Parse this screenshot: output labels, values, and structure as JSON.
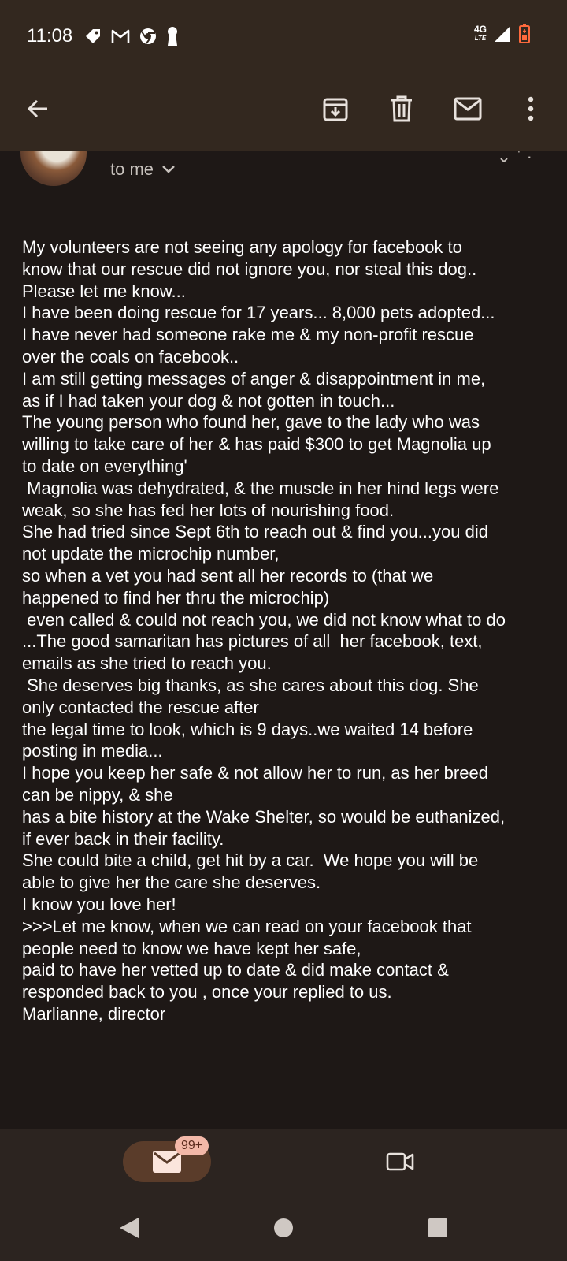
{
  "status_bar": {
    "time": "11:08",
    "network": "4G",
    "network_sub": "LTE",
    "icons": [
      "tag-icon",
      "gmail-icon",
      "chrome-icon",
      "keyhole-icon",
      "signal-icon",
      "battery-icon"
    ]
  },
  "toolbar": {
    "icons": [
      "back-arrow-icon",
      "archive-icon",
      "delete-icon",
      "mark-unread-icon",
      "more-vert-icon"
    ]
  },
  "message": {
    "recipient_label": "to me",
    "body_lines": [
      "My volunteers are not seeing any apology for facebook to",
      "know that our rescue did not ignore you, nor steal this dog..",
      "Please let me know...",
      "I have been doing rescue for 17 years... 8,000 pets adopted...",
      "I have never had someone rake me & my non-profit rescue",
      "over the coals on facebook..",
      "I am still getting messages of anger & disappointment in me,",
      "as if I had taken your dog & not gotten in touch...",
      "The young person who found her, gave to the lady who was",
      "willing to take care of her & has paid $300 to get Magnolia up",
      "to date on everything'",
      " Magnolia was dehydrated, & the muscle in her hind legs were",
      "weak, so she has fed her lots of nourishing food.",
      "She had tried since Sept 6th to reach out & find you...you did",
      "not update the microchip number,",
      "so when a vet you had sent all her records to (that we",
      "happened to find her thru the microchip)",
      " even called & could not reach you, we did not know what to do",
      "...The good samaritan has pictures of all  her facebook, text,",
      "emails as she tried to reach you.",
      " She deserves big thanks, as she cares about this dog. She",
      "only contacted the rescue after",
      "the legal time to look, which is 9 days..we waited 14 before",
      "posting in media...",
      "I hope you keep her safe & not allow her to run, as her breed",
      "can be nippy, & she",
      "has a bite history at the Wake Shelter, so would be euthanized,",
      "if ever back in their facility.",
      "She could bite a child, get hit by a car.  We hope you will be",
      "able to give her the care she deserves.",
      "I know you love her!",
      ">>>Let me know, when we can read on your facebook that",
      "people need to know we have kept her safe,",
      "paid to have her vetted up to date & did make contact &",
      "responded back to you , once your replied to us.",
      "Marlianne, director"
    ]
  },
  "bottom_nav": {
    "mail_badge": "99+"
  },
  "colors": {
    "topbar": "#33281f",
    "background": "#1e1816",
    "nav_pill": "#5a3c2a",
    "badge": "#f3b8a8"
  }
}
